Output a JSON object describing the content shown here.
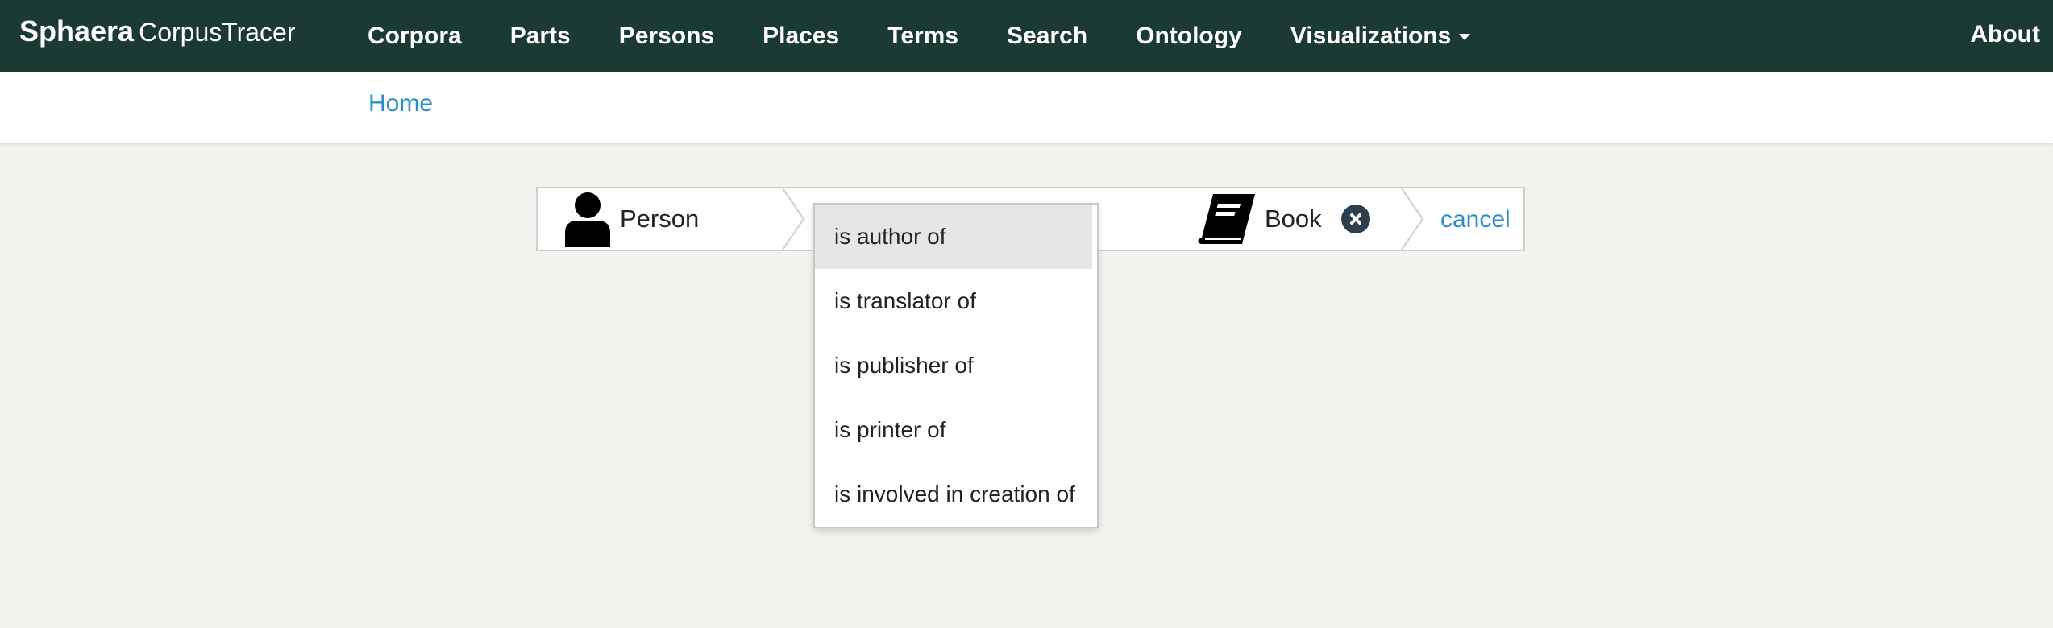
{
  "navbar": {
    "brand_bold": "Sphaera",
    "brand_rest": "CorpusTracer",
    "items": [
      "Corpora",
      "Parts",
      "Persons",
      "Places",
      "Terms",
      "Search",
      "Ontology",
      "Visualizations"
    ],
    "about": "About",
    "background": "#1b3a34"
  },
  "breadcrumb": {
    "home": "Home"
  },
  "query": {
    "subject": {
      "label": "Person",
      "icon": "person-icon"
    },
    "object": {
      "label": "Book",
      "icon": "book-icon"
    },
    "cancel": "cancel"
  },
  "dropdown": {
    "options": [
      "is author of",
      "is translator of",
      "is publisher of",
      "is printer of",
      "is involved in creation of"
    ],
    "highlighted": "is author of"
  },
  "colors": {
    "link": "#2a8fc9",
    "page_bg": "#f3f2ee"
  }
}
